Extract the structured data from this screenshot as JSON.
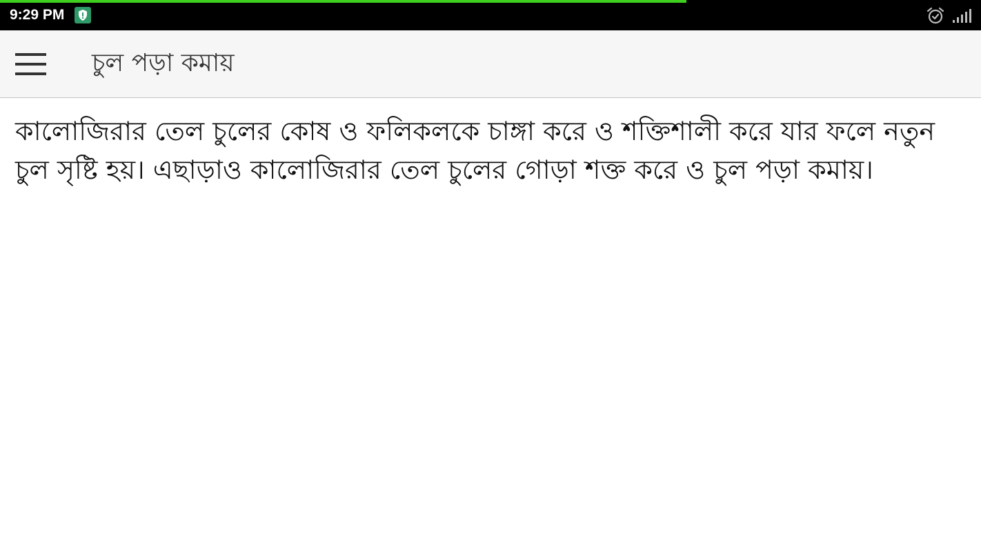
{
  "status_bar": {
    "time": "9:29 PM",
    "notification_icon": "shield-icon",
    "alarm_icon": "alarm-clock-icon",
    "signal_icon": "cell-signal-icon",
    "progress": 0.7,
    "colors": {
      "background": "#000000",
      "progress": "#3fcf1f",
      "notification": "#2e9a68"
    }
  },
  "app_bar": {
    "menu_icon": "hamburger-menu-icon",
    "title": "চুল পড়া কমায়"
  },
  "content": {
    "body": "কালোজিরার তেল চুলের কোষ ও ফলিকলকে চাঙ্গা করে ও শক্তিশালী করে যার ফলে নতুন চুল সৃষ্টি হয়। এছাড়াও কালোজিরার তেল চুলের গোড়া শক্ত করে ও চুল পড়া কমায়।"
  }
}
